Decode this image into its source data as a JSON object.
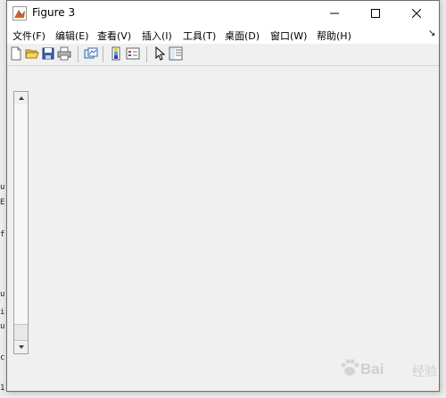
{
  "window": {
    "title": "Figure 3",
    "controls": [
      "minimize",
      "maximize",
      "close"
    ]
  },
  "menubar": {
    "items": [
      {
        "label": "文件(F)"
      },
      {
        "label": "编辑(E)"
      },
      {
        "label": "查看(V)"
      },
      {
        "label": "插入(I)"
      },
      {
        "label": "工具(T)"
      },
      {
        "label": "桌面(D)"
      },
      {
        "label": "窗口(W)"
      },
      {
        "label": "帮助(H)"
      }
    ],
    "dock_icon": "dock-arrow-icon"
  },
  "toolbar": {
    "icons": [
      "new-figure-icon",
      "open-file-icon",
      "save-icon",
      "print-icon",
      "link-plot-icon",
      "colorbar-icon",
      "legend-icon",
      "pointer-icon",
      "property-inspector-icon"
    ]
  },
  "watermark": {
    "text": "Bai",
    "sub": "经验"
  },
  "background": {
    "fragments": [
      "u",
      "E",
      "f",
      "u",
      "i",
      "u",
      "c",
      "1"
    ]
  }
}
